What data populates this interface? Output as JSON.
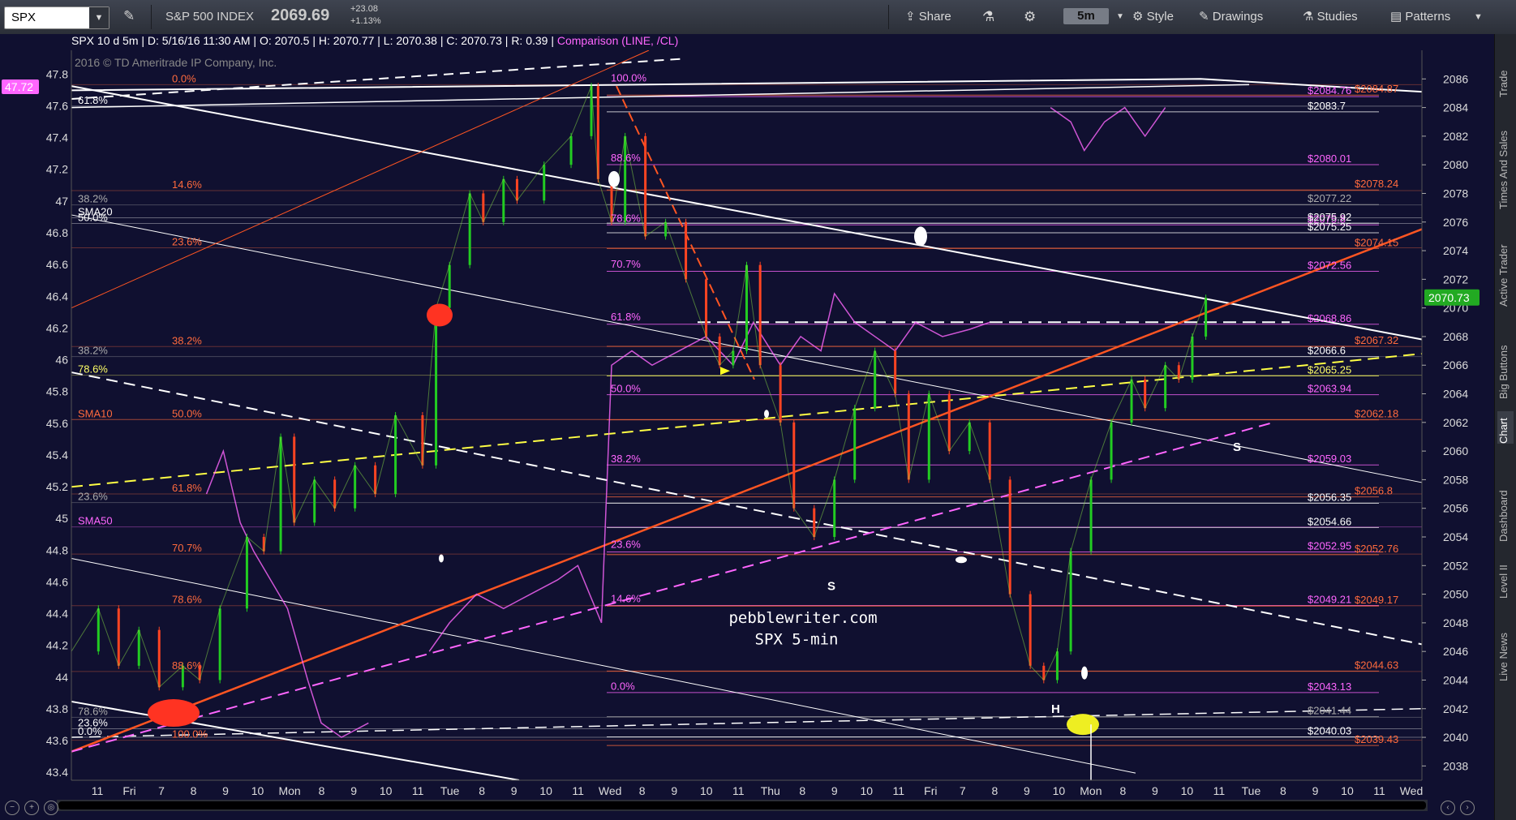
{
  "toolbar": {
    "symbol": "SPX",
    "index_name": "S&P 500 INDEX",
    "price": "2069.69",
    "change": "+23.08",
    "change_pct": "+1.13%",
    "share": "Share",
    "timeframe": "5m",
    "style": "Style",
    "drawings": "Drawings",
    "studies": "Studies",
    "patterns": "Patterns"
  },
  "header": {
    "desc": "SPX 10 d 5m",
    "date": "D: 5/16/16 11:30 AM",
    "open": "O: 2070.5",
    "high": "H: 2070.77",
    "low": "L: 2070.38",
    "close": "C: 2070.73",
    "range": "R: 0.39",
    "comparison": "Comparison (LINE, /CL)"
  },
  "copyright": "2016 © TD Ameritrade IP Company, Inc.",
  "watermark": [
    "pebblewriter.com",
    "SPX 5-min"
  ],
  "annotations": {
    "s1": "S",
    "s2": "S",
    "h": "H"
  },
  "sidebar_tabs": [
    "Trade",
    "Times And Sales",
    "Active Trader",
    "Big Buttons",
    "Chart",
    "Dashboard",
    "Level II",
    "Live News"
  ],
  "colors": {
    "background": "#101030",
    "up": "#22cc22",
    "down": "#ff4422",
    "fib_orange": "#ff6a3d",
    "fib_magenta": "#ff66ff",
    "last_price_bg": "#22aa22"
  },
  "chart_data": {
    "type": "line",
    "title": "",
    "price_scale": {
      "side": "right",
      "ticks": [
        "2086",
        "2084",
        "2082",
        "2080",
        "2078",
        "2076",
        "2074",
        "2072",
        "2070",
        "2068",
        "2066",
        "2064",
        "2062",
        "2060",
        "2058",
        "2056",
        "2054",
        "2052",
        "2050",
        "2048",
        "2046",
        "2044",
        "2042",
        "2040",
        "2038"
      ],
      "range": [
        2037,
        2088
      ]
    },
    "comparison_scale": {
      "side": "left",
      "ticks": [
        "47.8",
        "47.6",
        "47.4",
        "47.2",
        "47",
        "46.8",
        "46.6",
        "46.4",
        "46.2",
        "46",
        "45.8",
        "45.6",
        "45.4",
        "45.2",
        "45",
        "44.8",
        "44.6",
        "44.4",
        "44.2",
        "44",
        "43.8",
        "43.6",
        "43.4"
      ],
      "current": "47.72"
    },
    "time_axis": [
      "11",
      "Fri",
      "7",
      "8",
      "9",
      "10",
      "Mon",
      "8",
      "9",
      "10",
      "11",
      "Tue",
      "8",
      "9",
      "10",
      "11",
      "Wed",
      "8",
      "9",
      "10",
      "11",
      "Thu",
      "8",
      "9",
      "10",
      "11",
      "Fri",
      "7",
      "8",
      "9",
      "10",
      "Mon",
      "8",
      "9",
      "10",
      "11",
      "Tue",
      "8",
      "9",
      "10",
      "11",
      "Wed"
    ],
    "last_price": "2070.73",
    "level_labels": [
      {
        "label": "$2084.76",
        "color": "#ff66ff",
        "price": 2084.76
      },
      {
        "label": "$2084.87",
        "color": "#ff6a3d",
        "price": 2084.87
      },
      {
        "label": "$2083.7",
        "color": "#ffffff",
        "price": 2083.7
      },
      {
        "label": "$2080.01",
        "color": "#ff66ff",
        "price": 2080.01
      },
      {
        "label": "$2078.24",
        "color": "#ff6a3d",
        "price": 2078.24
      },
      {
        "label": "$2077.22",
        "color": "#aaaaaa",
        "price": 2077.22
      },
      {
        "label": "$2075.8",
        "color": "#ff66ff",
        "price": 2075.8
      },
      {
        "label": "$2075.92",
        "color": "#ffffff",
        "price": 2075.92
      },
      {
        "label": "$2075.25",
        "color": "#ffffff",
        "price": 2075.25
      },
      {
        "label": "$2074.15",
        "color": "#ff6a3d",
        "price": 2074.15
      },
      {
        "label": "$2072.56",
        "color": "#ff66ff",
        "price": 2072.56
      },
      {
        "label": "$2068.86",
        "color": "#ff66ff",
        "price": 2068.86
      },
      {
        "label": "$2067.32",
        "color": "#ff6a3d",
        "price": 2067.32
      },
      {
        "label": "$2066.6",
        "color": "#ffffff",
        "price": 2066.6
      },
      {
        "label": "$2065.25",
        "color": "#ffff66",
        "price": 2065.25
      },
      {
        "label": "$2063.94",
        "color": "#ff66ff",
        "price": 2063.94
      },
      {
        "label": "$2062.18",
        "color": "#ff6a3d",
        "price": 2062.18
      },
      {
        "label": "$2059.03",
        "color": "#ff66ff",
        "price": 2059.03
      },
      {
        "label": "$2056.8",
        "color": "#ff6a3d",
        "price": 2056.8
      },
      {
        "label": "$2056.35",
        "color": "#ffffff",
        "price": 2056.35
      },
      {
        "label": "$2054.66",
        "color": "#ffffff",
        "price": 2054.66
      },
      {
        "label": "$2052.95",
        "color": "#ff66ff",
        "price": 2052.95
      },
      {
        "label": "$2052.76",
        "color": "#ff6a3d",
        "price": 2052.76
      },
      {
        "label": "$2049.21",
        "color": "#ff66ff",
        "price": 2049.21
      },
      {
        "label": "$2049.17",
        "color": "#ff6a3d",
        "price": 2049.17
      },
      {
        "label": "$2044.63",
        "color": "#ff6a3d",
        "price": 2044.63
      },
      {
        "label": "$2043.13",
        "color": "#ff66ff",
        "price": 2043.13
      },
      {
        "label": "$2041.44",
        "color": "#aaaaaa",
        "price": 2041.44
      },
      {
        "label": "$2040.03",
        "color": "#ffffff",
        "price": 2040.03
      },
      {
        "label": "$2039.43",
        "color": "#ff6a3d",
        "price": 2039.43
      }
    ],
    "fib_labels_left": [
      {
        "label": "0.0%",
        "color": "#ff6a3d",
        "price": 2085.6
      },
      {
        "label": "61.8%",
        "color": "#ffffff",
        "price": 2084.1
      },
      {
        "label": "38.2%",
        "color": "#aaaaaa",
        "price": 2077.2
      },
      {
        "label": "SMA20",
        "color": "#ffffff",
        "price": 2076.3
      },
      {
        "label": "50.0%",
        "color": "#ffffff",
        "price": 2075.9
      },
      {
        "label": "14.6%",
        "color": "#ff6a3d",
        "price": 2078.2
      },
      {
        "label": "23.6%",
        "color": "#ff6a3d",
        "price": 2074.2
      },
      {
        "label": "38.2%",
        "color": "#ff6a3d",
        "price": 2067.3
      },
      {
        "label": "38.2%",
        "color": "#aaaaaa",
        "price": 2066.6
      },
      {
        "label": "78.6%",
        "color": "#ffff66",
        "price": 2065.3
      },
      {
        "label": "SMA10",
        "color": "#ff6a3d",
        "price": 2062.2
      },
      {
        "label": "50.0%",
        "color": "#ff6a3d",
        "price": 2062.2
      },
      {
        "label": "23.6%",
        "color": "#aaaaaa",
        "price": 2056.4
      },
      {
        "label": "61.8%",
        "color": "#ff6a3d",
        "price": 2057.0
      },
      {
        "label": "SMA50",
        "color": "#ff66ff",
        "price": 2054.7
      },
      {
        "label": "70.7%",
        "color": "#ff6a3d",
        "price": 2052.8
      },
      {
        "label": "78.6%",
        "color": "#ff6a3d",
        "price": 2049.2
      },
      {
        "label": "88.6%",
        "color": "#ff6a3d",
        "price": 2044.6
      },
      {
        "label": "78.6%",
        "color": "#aaaaaa",
        "price": 2041.4
      },
      {
        "label": "23.6%",
        "color": "#ffffff",
        "price": 2040.6
      },
      {
        "label": "0.0%",
        "color": "#ffffff",
        "price": 2040.0
      },
      {
        "label": "100.0%",
        "color": "#ff6a3d",
        "price": 2039.8
      }
    ],
    "fib_labels_mid": [
      {
        "label": "100.0%",
        "price": 2085.6
      },
      {
        "label": "88.6%",
        "price": 2080.0
      },
      {
        "label": "78.6%",
        "price": 2075.8
      },
      {
        "label": "70.7%",
        "price": 2072.6
      },
      {
        "label": "61.8%",
        "price": 2068.9
      },
      {
        "label": "50.0%",
        "price": 2063.9
      },
      {
        "label": "38.2%",
        "price": 2059.0
      },
      {
        "label": "23.6%",
        "price": 2053.0
      },
      {
        "label": "14.6%",
        "price": 2049.2
      },
      {
        "label": "0.0%",
        "price": 2043.1
      }
    ],
    "price_path": [
      {
        "t": 0,
        "p": 2046
      },
      {
        "t": 8,
        "p": 2049
      },
      {
        "t": 14,
        "p": 2045
      },
      {
        "t": 20,
        "p": 2047.5
      },
      {
        "t": 26,
        "p": 2043.5
      },
      {
        "t": 33,
        "p": 2045
      },
      {
        "t": 38,
        "p": 2044
      },
      {
        "t": 44,
        "p": 2049
      },
      {
        "t": 52,
        "p": 2054
      },
      {
        "t": 57,
        "p": 2053
      },
      {
        "t": 62,
        "p": 2061
      },
      {
        "t": 66,
        "p": 2055
      },
      {
        "t": 72,
        "p": 2058
      },
      {
        "t": 78,
        "p": 2056
      },
      {
        "t": 84,
        "p": 2059
      },
      {
        "t": 90,
        "p": 2057
      },
      {
        "t": 96,
        "p": 2062.5
      },
      {
        "t": 104,
        "p": 2059
      },
      {
        "t": 108,
        "p": 2070
      },
      {
        "t": 112,
        "p": 2073
      },
      {
        "t": 118,
        "p": 2078
      },
      {
        "t": 122,
        "p": 2076
      },
      {
        "t": 128,
        "p": 2079
      },
      {
        "t": 132,
        "p": 2077.5
      },
      {
        "t": 140,
        "p": 2080
      },
      {
        "t": 148,
        "p": 2082
      },
      {
        "t": 154,
        "p": 2085.5
      },
      {
        "t": 156,
        "p": 2079
      },
      {
        "t": 160,
        "p": 2076
      },
      {
        "t": 164,
        "p": 2082
      },
      {
        "t": 170,
        "p": 2075
      },
      {
        "t": 176,
        "p": 2076
      },
      {
        "t": 182,
        "p": 2072
      },
      {
        "t": 188,
        "p": 2068
      },
      {
        "t": 192,
        "p": 2066
      },
      {
        "t": 196,
        "p": 2067
      },
      {
        "t": 200,
        "p": 2073
      },
      {
        "t": 204,
        "p": 2066
      },
      {
        "t": 210,
        "p": 2062
      },
      {
        "t": 214,
        "p": 2056
      },
      {
        "t": 220,
        "p": 2054
      },
      {
        "t": 226,
        "p": 2058
      },
      {
        "t": 232,
        "p": 2063
      },
      {
        "t": 238,
        "p": 2067
      },
      {
        "t": 244,
        "p": 2064
      },
      {
        "t": 248,
        "p": 2058
      },
      {
        "t": 254,
        "p": 2064
      },
      {
        "t": 260,
        "p": 2060
      },
      {
        "t": 266,
        "p": 2062
      },
      {
        "t": 272,
        "p": 2058
      },
      {
        "t": 278,
        "p": 2050
      },
      {
        "t": 284,
        "p": 2045
      },
      {
        "t": 288,
        "p": 2044
      },
      {
        "t": 292,
        "p": 2046
      },
      {
        "t": 296,
        "p": 2053
      },
      {
        "t": 302,
        "p": 2058
      },
      {
        "t": 308,
        "p": 2062
      },
      {
        "t": 314,
        "p": 2065
      },
      {
        "t": 318,
        "p": 2063
      },
      {
        "t": 324,
        "p": 2066
      },
      {
        "t": 328,
        "p": 2065
      },
      {
        "t": 332,
        "p": 2068
      },
      {
        "t": 336,
        "p": 2070.7
      }
    ],
    "comparison_path": [
      {
        "t": 40,
        "p": 2057
      },
      {
        "t": 45,
        "p": 2060
      },
      {
        "t": 50,
        "p": 2055
      },
      {
        "t": 54,
        "p": 2053
      },
      {
        "t": 64,
        "p": 2049
      },
      {
        "t": 70,
        "p": 2044
      },
      {
        "t": 74,
        "p": 2041
      },
      {
        "t": 80,
        "p": 2040
      },
      {
        "t": 88,
        "p": 2041
      },
      {
        "t": 106,
        "p": 2046
      },
      {
        "t": 112,
        "p": 2048
      },
      {
        "t": 120,
        "p": 2050
      },
      {
        "t": 128,
        "p": 2049
      },
      {
        "t": 136,
        "p": 2050
      },
      {
        "t": 144,
        "p": 2051
      },
      {
        "t": 150,
        "p": 2052
      },
      {
        "t": 157,
        "p": 2048
      },
      {
        "t": 160,
        "p": 2066
      },
      {
        "t": 166,
        "p": 2067
      },
      {
        "t": 172,
        "p": 2066
      },
      {
        "t": 180,
        "p": 2067
      },
      {
        "t": 188,
        "p": 2068
      },
      {
        "t": 196,
        "p": 2066
      },
      {
        "t": 202,
        "p": 2069
      },
      {
        "t": 210,
        "p": 2066
      },
      {
        "t": 216,
        "p": 2068
      },
      {
        "t": 222,
        "p": 2067
      },
      {
        "t": 226,
        "p": 2071
      },
      {
        "t": 232,
        "p": 2069
      },
      {
        "t": 238,
        "p": 2068
      },
      {
        "t": 244,
        "p": 2067
      },
      {
        "t": 250,
        "p": 2069
      },
      {
        "t": 258,
        "p": 2068
      },
      {
        "t": 266,
        "p": 2068.5
      },
      {
        "t": 272,
        "p": 2069
      },
      {
        "t": 290,
        "p": 2084
      },
      {
        "t": 296,
        "p": 2083
      },
      {
        "t": 300,
        "p": 2081
      },
      {
        "t": 306,
        "p": 2083
      },
      {
        "t": 312,
        "p": 2084
      },
      {
        "t": 318,
        "p": 2082
      },
      {
        "t": 324,
        "p": 2084
      }
    ]
  }
}
